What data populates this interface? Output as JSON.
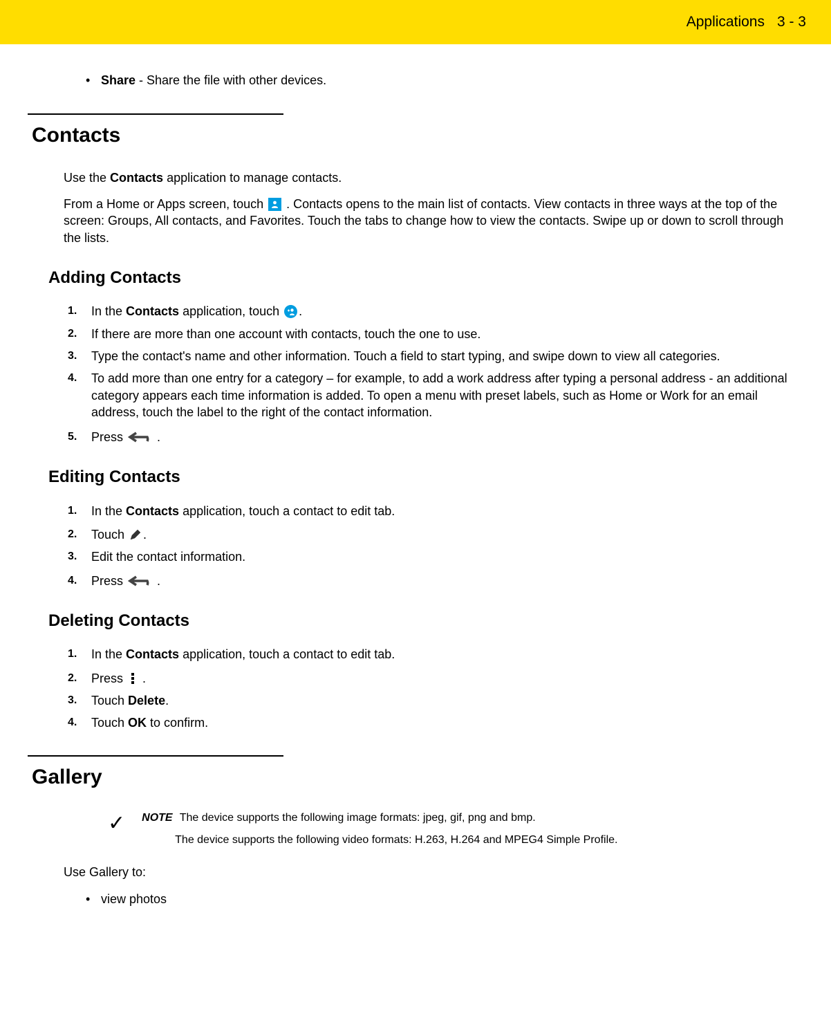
{
  "header": {
    "chapter": "Applications",
    "page": "3 - 3"
  },
  "share_bullet": {
    "bold": "Share",
    "rest": " - Share the file with other devices."
  },
  "contacts": {
    "title": "Contacts",
    "intro1_a": "Use the ",
    "intro1_b": "Contacts",
    "intro1_c": " application to manage contacts.",
    "intro2_a": "From a Home or Apps screen, touch ",
    "intro2_b": ". Contacts opens to the main list of contacts. View contacts in three ways at the top of the screen: Groups, All contacts, and Favorites. Touch the tabs to change how to view the contacts. Swipe up or down to scroll through the lists.",
    "adding": {
      "title": "Adding Contacts",
      "s1_a": "In the ",
      "s1_b": "Contacts",
      "s1_c": " application, touch ",
      "s1_d": ".",
      "s2": "If there are more than one account with contacts, touch the one to use.",
      "s3": "Type the contact's name and other information. Touch a field to start typing, and swipe down to view all categories.",
      "s4": "To add more than one entry for a category – for example, to add a work address after typing a personal address - an additional category appears each time information is added. To open a menu with preset labels, such as Home or Work for an email address, touch the label to the right of the contact information.",
      "s5_a": "Press ",
      "s5_b": "."
    },
    "editing": {
      "title": "Editing Contacts",
      "s1_a": "In the ",
      "s1_b": "Contacts",
      "s1_c": " application, touch a contact to edit tab.",
      "s2_a": "Touch ",
      "s2_b": ".",
      "s3": "Edit the contact information.",
      "s4_a": "Press ",
      "s4_b": "."
    },
    "deleting": {
      "title": "Deleting Contacts",
      "s1_a": "In the ",
      "s1_b": "Contacts",
      "s1_c": " application, touch a contact to edit tab.",
      "s2_a": "Press  ",
      "s2_b": ".",
      "s3_a": "Touch ",
      "s3_b": "Delete",
      "s3_c": ".",
      "s4_a": "Touch ",
      "s4_b": "OK",
      "s4_c": " to confirm."
    }
  },
  "gallery": {
    "title": "Gallery",
    "note_label": "NOTE",
    "note1": "The device supports the following image formats: jpeg, gif, png and bmp.",
    "note2": "The device supports the following video formats: H.263, H.264 and MPEG4 Simple Profile.",
    "use_intro": "Use Gallery to:",
    "bullet1": "view photos"
  }
}
